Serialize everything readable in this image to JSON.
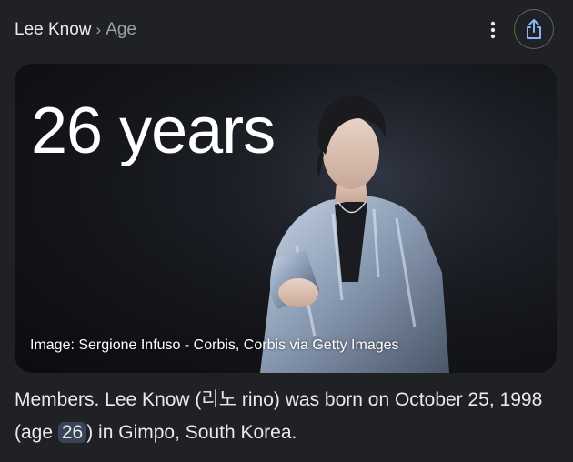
{
  "breadcrumb": {
    "entity": "Lee Know",
    "separator": "›",
    "attribute": "Age"
  },
  "icons": {
    "more": "more-vert-icon",
    "share": "share-icon"
  },
  "answer": {
    "age_label": "26 years"
  },
  "image_credit": "Image: Sergione Infuso - Corbis, Corbis via Getty Images",
  "description": {
    "before": "Members. Lee Know (리노 rino) was born on October 25, 1998 (age ",
    "highlight": "26",
    "after": ") in Gimpo, South Korea."
  },
  "colors": {
    "background": "#202124",
    "text": "#e8eaed",
    "muted": "#9aa0a6",
    "highlight_bg": "#394457"
  }
}
